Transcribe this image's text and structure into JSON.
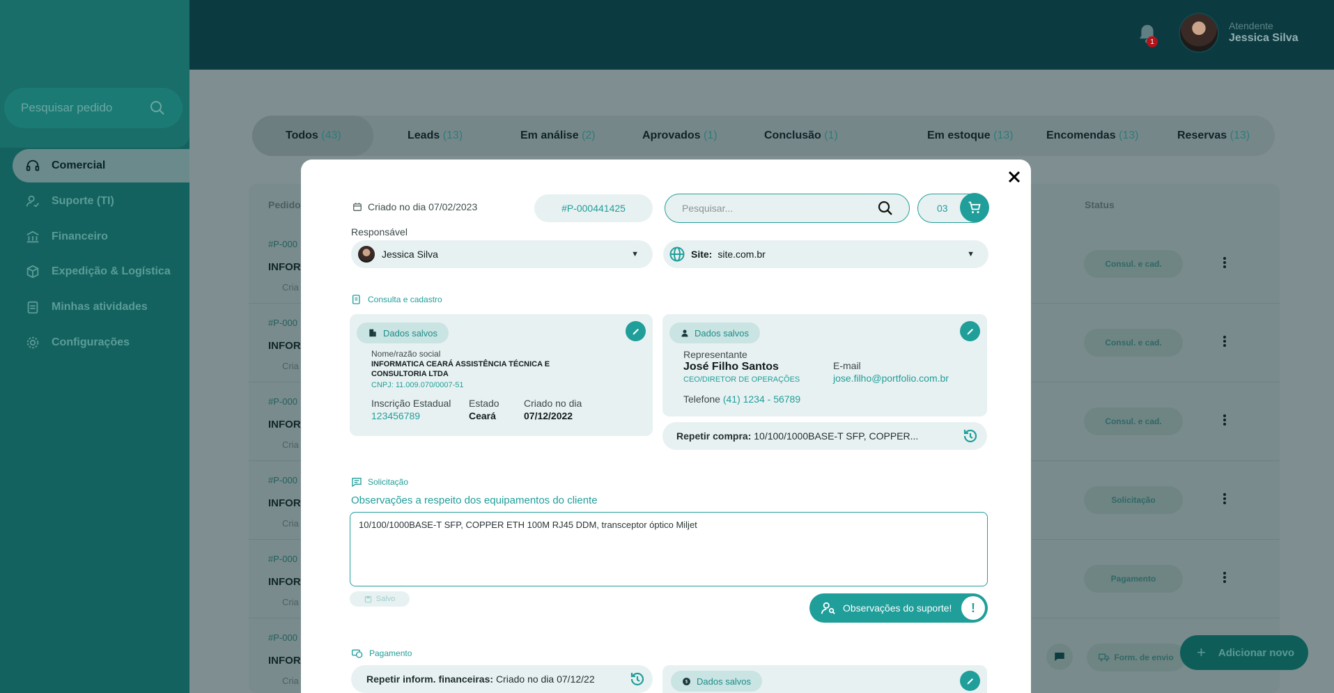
{
  "sidebar": {
    "search_placeholder": "Pesquisar pedido",
    "items": [
      {
        "label": "Comercial",
        "active": true
      },
      {
        "label": "Suporte (TI)"
      },
      {
        "label": "Financeiro"
      },
      {
        "label": "Expedição & Logística"
      },
      {
        "label": "Minhas atividades"
      },
      {
        "label": "Configurações"
      }
    ]
  },
  "header": {
    "notification_count": "1",
    "user_role": "Atendente",
    "user_name": "Jessica Silva"
  },
  "tabs": [
    {
      "label": "Todos",
      "count": "(43)"
    },
    {
      "label": "Leads",
      "count": "(13)"
    },
    {
      "label": "Em análise",
      "count": "(2)"
    },
    {
      "label": "Aprovados",
      "count": "(1)"
    },
    {
      "label": "Conclusão",
      "count": "(1)"
    },
    {
      "label": "Em estoque",
      "count": "(13)"
    },
    {
      "label": "Encomendas",
      "count": "(13)"
    },
    {
      "label": "Reservas",
      "count": "(13)"
    }
  ],
  "table": {
    "col_pedido": "Pedido",
    "col_status": "Status",
    "rows": [
      {
        "id": "#P-000",
        "title": "INFOR",
        "sub": "Cria",
        "status": "Consul. e cad."
      },
      {
        "id": "#P-000",
        "title": "INFOR",
        "sub": "Cria",
        "status": "Consul. e cad."
      },
      {
        "id": "#P-000",
        "title": "INFOR",
        "sub": "Cria",
        "status": "Consul. e cad."
      },
      {
        "id": "#P-000",
        "title": "INFOR",
        "sub": "Cria",
        "status": "Solicitação"
      },
      {
        "id": "#P-000",
        "title": "INFOR",
        "sub": "Cria",
        "status": "Pagamento"
      },
      {
        "id": "#P-000",
        "title": "INFOR",
        "sub": "Cria",
        "status": "Form. de envio"
      }
    ]
  },
  "add_button": "Adicionar novo",
  "modal": {
    "created": "Criado no dia 07/02/2023",
    "order_id": "#P-000441425",
    "search_placeholder": "Pesquisar...",
    "cart_count": "03",
    "responsible_label": "Responsável",
    "responsible_name": "Jessica Silva",
    "site_prefix": "Site:",
    "site_value": "site.com.br",
    "consulta": {
      "title": "Consulta e cadastro",
      "company": {
        "chip": "Dados salvos",
        "name_label": "Nome/razão social",
        "name": "INFORMATICA CEARÁ ASSISTÊNCIA TÉCNICA E CONSULTORIA LTDA",
        "cnpj": "CNPJ: 11.009.070/0007-51",
        "ie_label": "Inscrição Estadual",
        "ie_value": "123456789",
        "estado_label": "Estado",
        "estado_value": "Ceará",
        "criado_label": "Criado no dia",
        "criado_value": "07/12/2022"
      },
      "rep": {
        "chip": "Dados salvos",
        "rep_label": "Representante",
        "rep_name": "José Filho Santos",
        "rep_role": "CEO/DIRETOR DE OPERAÇÕES",
        "email_label": "E-mail",
        "email_value": "jose.filho@portfolio.com.br",
        "phone_label": "Telefone",
        "phone_value": "(41) 1234 - 56789"
      },
      "repeat_label": "Repetir compra:",
      "repeat_value": "10/100/1000BASE-T SFP, COPPER..."
    },
    "solicitacao": {
      "title": "Solicitação",
      "obs_label": "Observações a respeito dos equipamentos do cliente",
      "obs_value": "10/100/1000BASE-T SFP, COPPER ETH 100M RJ45 DDM, transceptor óptico Miljet",
      "saved": "Salvo",
      "support_button": "Observações do suporte!"
    },
    "pagamento": {
      "title": "Pagamento",
      "repeat_label": "Repetir inform. financeiras:",
      "repeat_value": "Criado no dia 07/12/22",
      "chip": "Dados salvos"
    }
  }
}
